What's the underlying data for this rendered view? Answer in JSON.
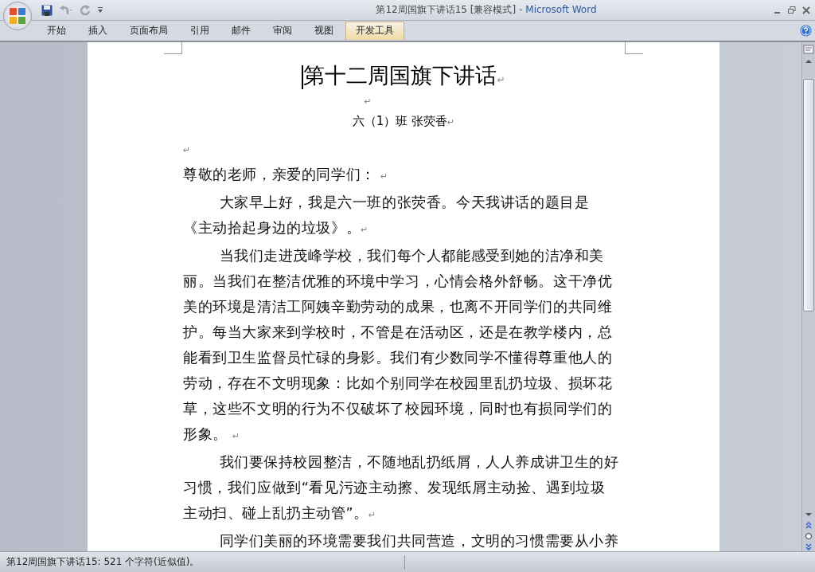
{
  "window": {
    "title": "第12周国旗下讲话15 [兼容模式]",
    "app": "- Microsoft Word"
  },
  "tabs": [
    {
      "label": "开始",
      "selected": false
    },
    {
      "label": "插入",
      "selected": false
    },
    {
      "label": "页面布局",
      "selected": false
    },
    {
      "label": "引用",
      "selected": false
    },
    {
      "label": "邮件",
      "selected": false
    },
    {
      "label": "审阅",
      "selected": false
    },
    {
      "label": "视图",
      "selected": false
    },
    {
      "label": "开发工具",
      "selected": true
    }
  ],
  "document": [
    {
      "kind": "title",
      "lines": [
        "第十二周国旗下讲话"
      ],
      "mark": "↵"
    },
    {
      "kind": "center_blank",
      "mark": "↵"
    },
    {
      "kind": "subtitle",
      "lines": [
        "六（1）班   张荧香"
      ],
      "mark": "↵"
    },
    {
      "kind": "blank",
      "mark": "↵"
    },
    {
      "kind": "body",
      "lines": [
        "尊敬的老师，亲爱的同学们： "
      ],
      "mark": "↵"
    },
    {
      "kind": "indented",
      "lines": [
        "大家早上好，我是六一班的张荧香。今天我讲话的题目是",
        "《主动拾起身边的垃圾》。"
      ],
      "mark": "↵"
    },
    {
      "kind": "indented",
      "lines": [
        "当我们走进茂峰学校，我们每个人都能感受到她的洁净和美",
        "丽。当我们在整洁优雅的环境中学习，心情会格外舒畅。这干净优",
        "美的环境是清洁工阿姨辛勤劳动的成果，也离不开同学们的共同维",
        "护。每当大家来到学校时，不管是在活动区，还是在教学楼内，总",
        "能看到卫生监督员忙碌的身影。我们有少数同学不懂得尊重他人的",
        "劳动，存在不文明现象：比如个别同学在校园里乱扔垃圾、损坏花",
        "草，这些不文明的行为不仅破坏了校园环境，同时也有损同学们的",
        "形象。 "
      ],
      "mark": "↵"
    },
    {
      "kind": "indented",
      "lines": [
        "我们要保持校园整洁，不随地乱扔纸屑，人人养成讲卫生的好",
        "习惯，我们应做到“看见污迹主动擦、发现纸屑主动捡、遇到垃圾",
        "主动扫、碰上乱扔主动管”。"
      ],
      "mark": "↵"
    },
    {
      "kind": "indented",
      "lines": [
        "同学们美丽的环境需要我们共同营造，文明的习惯需要从小养"
      ]
    }
  ],
  "status_bar": {
    "text": "第12周国旗下讲话15: 521 个字符(近似值)。"
  }
}
